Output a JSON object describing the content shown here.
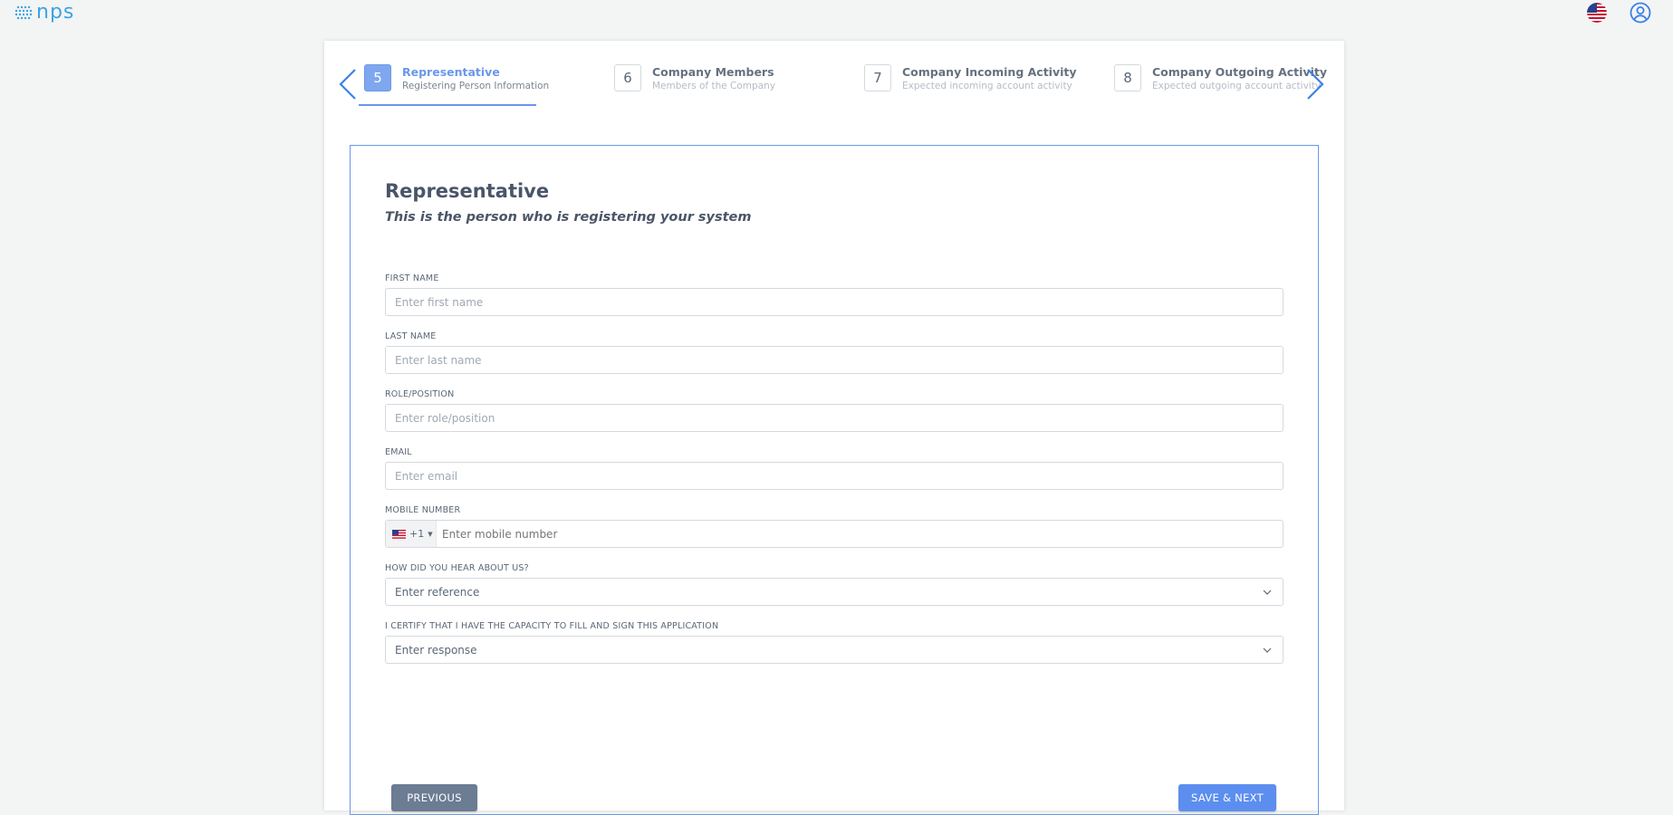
{
  "app": {
    "logo_text": "nps"
  },
  "stepper": {
    "steps": [
      {
        "number": "5",
        "title": "Representative",
        "subtitle": "Registering Person Information"
      },
      {
        "number": "6",
        "title": "Company Members",
        "subtitle": "Members of the Company"
      },
      {
        "number": "7",
        "title": "Company Incoming Activity",
        "subtitle": "Expected incoming account activity"
      },
      {
        "number": "8",
        "title": "Company Outgoing Activity",
        "subtitle": "Expected outgoing account activity"
      }
    ],
    "active_step": "5"
  },
  "form": {
    "title": "Representative",
    "subtitle": "This is the person who is registering your system",
    "fields": {
      "first_name": {
        "label": "FIRST NAME",
        "placeholder": "Enter first name"
      },
      "last_name": {
        "label": "LAST NAME",
        "placeholder": "Enter last name"
      },
      "role": {
        "label": "ROLE/POSITION",
        "placeholder": "Enter role/position"
      },
      "email": {
        "label": "EMAIL",
        "placeholder": "Enter email"
      },
      "mobile": {
        "label": "MOBILE NUMBER",
        "country_code": "+1",
        "placeholder": "Enter mobile number"
      },
      "reference": {
        "label": "HOW DID YOU HEAR ABOUT US?",
        "value": "Enter reference"
      },
      "certify": {
        "label": "I CERTIFY THAT I HAVE THE CAPACITY TO FILL AND SIGN THIS APPLICATION",
        "value": "Enter response"
      }
    },
    "buttons": {
      "previous": "PREVIOUS",
      "save_next": "SAVE & NEXT"
    }
  },
  "colors": {
    "accent": "#6b97ea",
    "primary_button": "#5c8ef0",
    "secondary_button": "#6b7c93",
    "logo": "#3ba3e6"
  }
}
